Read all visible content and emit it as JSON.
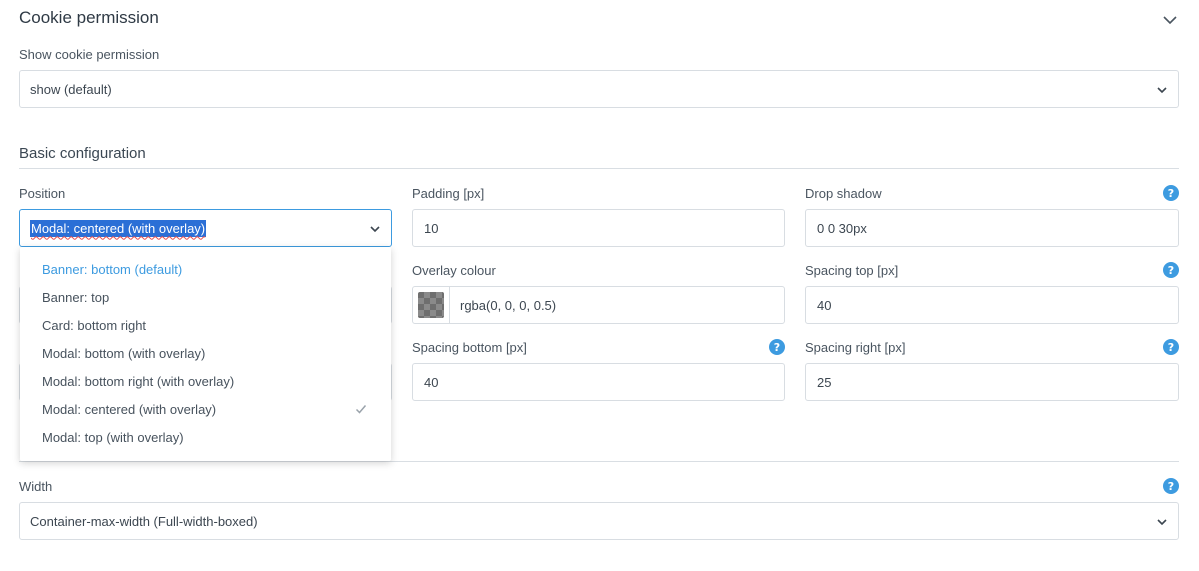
{
  "section": {
    "title": "Cookie permission"
  },
  "show_permission": {
    "label": "Show cookie permission",
    "value": "show (default)"
  },
  "basic": {
    "title": "Basic configuration"
  },
  "position": {
    "label": "Position",
    "value": "Modal: centered (with overlay)",
    "options": [
      "Banner: bottom (default)",
      "Banner: top",
      "Card: bottom right",
      "Modal: bottom (with overlay)",
      "Modal: bottom right (with overlay)",
      "Modal: centered (with overlay)",
      "Modal: top (with overlay)"
    ],
    "selected_option": "Modal: centered (with overlay)"
  },
  "padding": {
    "label": "Padding [px]",
    "value": "10"
  },
  "drop_shadow": {
    "label": "Drop shadow",
    "value": "0 0 30px"
  },
  "overlay_colour": {
    "label": "Overlay colour",
    "value": "rgba(0, 0, 0, 0.5)"
  },
  "spacing_top": {
    "label": "Spacing top [px]",
    "value": "40"
  },
  "spacing_bottom": {
    "label": "Spacing bottom [px]",
    "value": "40"
  },
  "spacing_right": {
    "label": "Spacing right [px]",
    "value": "25"
  },
  "width": {
    "label": "Width",
    "value": "Container-max-width (Full-width-boxed)"
  },
  "help_glyph": "?",
  "colors": {
    "accent": "#3d9be0",
    "selection": "#2b6fd6",
    "border": "#d8dde2"
  },
  "icons": {
    "collapse": "chevron-down-icon",
    "help": "help-icon",
    "check": "check-icon"
  }
}
